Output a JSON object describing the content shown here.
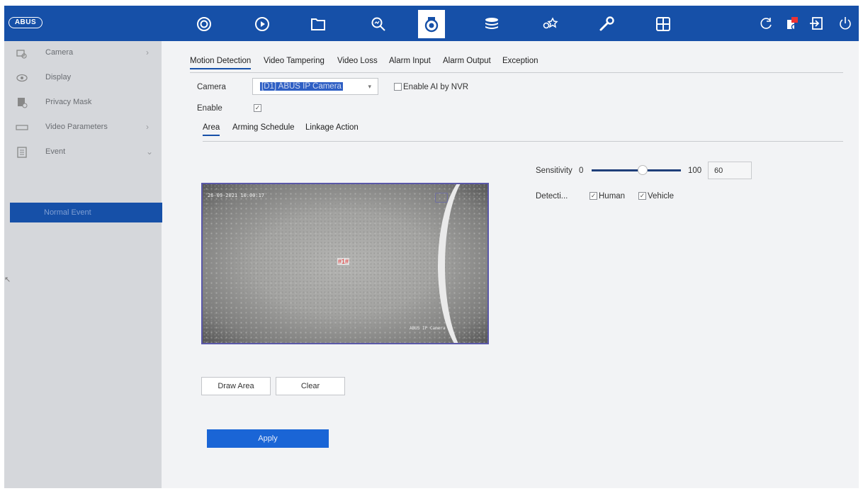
{
  "topbar": {
    "logo": "ABUS",
    "nav": [
      "live-view-icon",
      "playback-icon",
      "file-icon",
      "search-icon",
      "camera-icon",
      "storage-icon",
      "smart-icon",
      "maintenance-icon",
      "system-icon"
    ],
    "active": "camera-icon"
  },
  "sidebar": {
    "items": [
      {
        "label": "Camera",
        "icon": "camera-icon"
      },
      {
        "label": "Display",
        "icon": "eye-icon"
      },
      {
        "label": "Privacy Mask",
        "icon": "privacy-mask-icon"
      },
      {
        "label": "Video Parameters",
        "icon": "video-parameters-icon"
      },
      {
        "label": "Event",
        "icon": "event-icon"
      }
    ],
    "selected_sub": "Normal Event"
  },
  "main": {
    "tabs": [
      "Motion Detection",
      "Video Tampering",
      "Video Loss",
      "Alarm Input",
      "Alarm Output",
      "Exception"
    ],
    "camera_label": "Camera",
    "camera_value": "[D1] ABUS IP Camera",
    "enable_ai_label": "Enable AI by NVR",
    "enable_ai_checked": false,
    "enable_label": "Enable",
    "enable_checked": true,
    "subtabs": [
      "Area",
      "Arming Schedule",
      "Linkage Action"
    ],
    "video": {
      "timestamp": "26-09-2021 10:00:17",
      "camera_name": "ABUS IP Camera",
      "zone": "#1#"
    },
    "draw_area": "Draw Area",
    "clear": "Clear",
    "apply": "Apply",
    "sensitivity_label": "Sensitivity",
    "sensitivity_min": "0",
    "sensitivity_max": "100",
    "sensitivity_value": "60",
    "detection_label": "Detecti...",
    "human_label": "Human",
    "human_checked": true,
    "vehicle_label": "Vehicle",
    "vehicle_checked": true
  }
}
